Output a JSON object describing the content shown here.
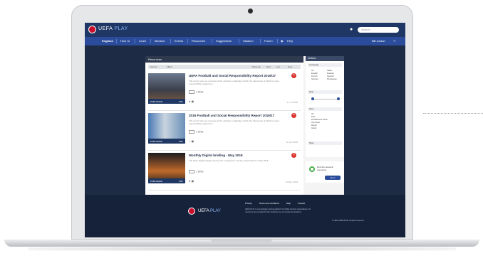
{
  "app": {
    "brand": "UEFA",
    "brand_suffix": "PLAY"
  },
  "header": {
    "search_placeholder": "Search"
  },
  "nav": {
    "items": [
      "England",
      "How To",
      "Learn",
      "Medical",
      "Events",
      "Resources",
      "Suggestions",
      "Stadium",
      "Forum",
      "FAQ"
    ],
    "account": "Bill Jordan"
  },
  "main": {
    "section_title": "Resources",
    "toolbar": {
      "left_a": "Sort by",
      "left_b": "Filters",
      "right_a": "Show all",
      "right_b": "Grid",
      "right_c": "List",
      "right_d": "Next"
    },
    "items": [
      {
        "title": "UEFA Football and Social Responsibility Report 2016/17",
        "desc": "This report gives an overview of the activities undertaken within the framework of UEFA's social responsibility programme.",
        "thumb_label": "PUBLISHED",
        "thumb_tag": "PDF",
        "lang": "1 ENG",
        "date": "17 Jul 2018"
      },
      {
        "title": "2016 Football and Social Responsibility Report 2016/17",
        "desc": "This report gives an overview of the activities undertaken within the framework of UEFA's social responsibility programme.",
        "thumb_label": "PUBLISHED",
        "thumb_tag": "PDF",
        "lang": "1 ENG",
        "date": "12 Jun 2018"
      },
      {
        "title": "Monthly Digital briefing - May 2018",
        "desc": "The latest digital insights and trends compiled for member associations in May 2018.",
        "thumb_label": "PUBLISHED",
        "thumb_tag": "PDF",
        "lang": "1 ENG",
        "date": "31 May 2018"
      }
    ]
  },
  "criteria": {
    "title": "Criteria",
    "sections": [
      "Language",
      "Date",
      "Type",
      "Tags"
    ],
    "language_options": [
      "All",
      "English",
      "French",
      "German",
      "Italian",
      "Russian",
      "Spanish",
      "Portuguese"
    ],
    "type_options": [
      "All",
      "Files",
      "Football and social",
      "Info sheet",
      "Report",
      "Guide"
    ]
  },
  "promo": {
    "text": "Find the relevant resources",
    "button": "Go to"
  },
  "footer": {
    "brand": "UEFA",
    "brand_suffix": "PLAY",
    "links": [
      "Privacy",
      "Terms and conditions",
      "Help",
      "Contact"
    ],
    "text": "UEFA PLAY is a knowledge sharing platform for UEFA member associations. All resources are provided for the exclusive use of member associations.",
    "copyright": "© UEFA 1998-2018. All rights reserved."
  },
  "colors": {
    "topbar": "#1f3764",
    "nav": "#2a4c9a",
    "accent_red": "#c8102e",
    "background": "#1e2b45"
  }
}
